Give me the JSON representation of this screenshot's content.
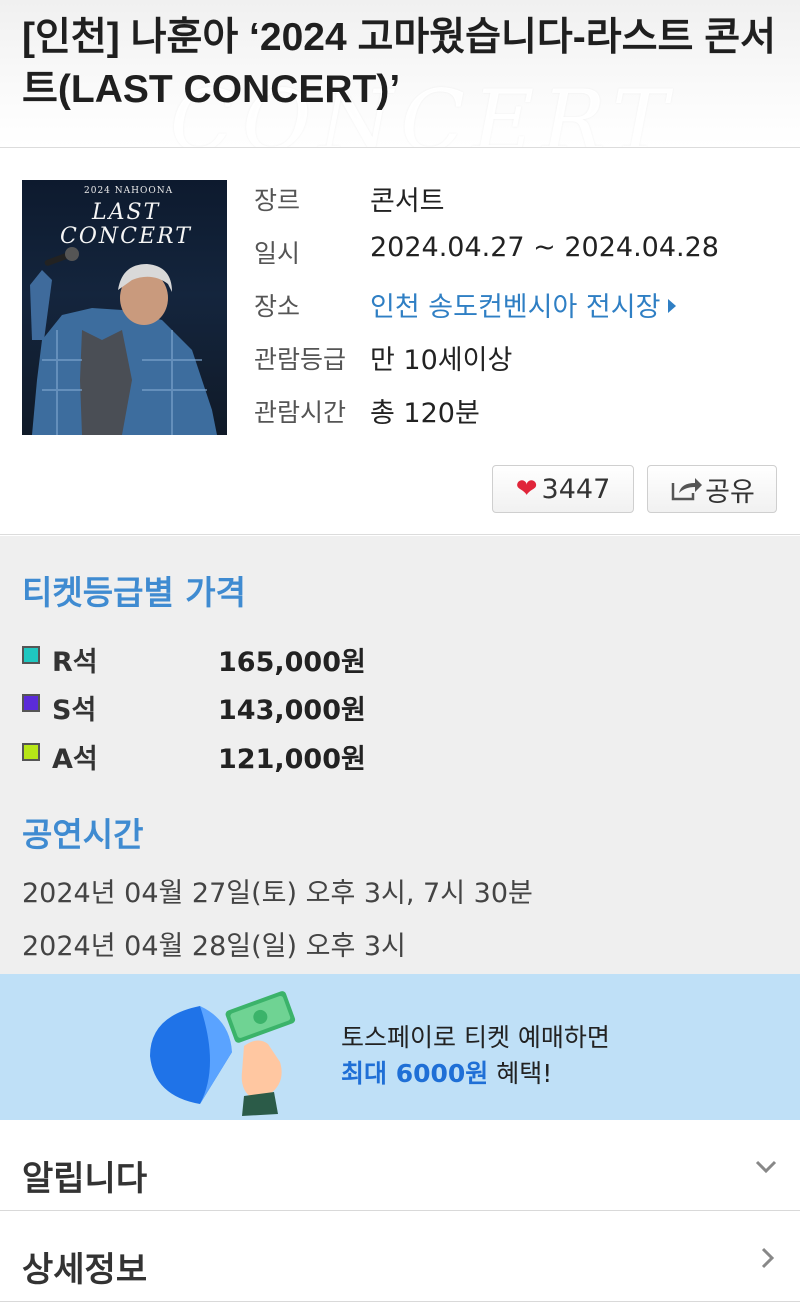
{
  "header": {
    "title": "[인천] 나훈아 ‘2024 고마웠습니다-라스트 콘서트(LAST CONCERT)’",
    "watermark": "CONCERT"
  },
  "poster": {
    "top_text": "2024 NAHOONA",
    "line1": "LAST",
    "line2": "CONCERT"
  },
  "info": {
    "rows": [
      {
        "label": "장르",
        "value": "콘서트"
      },
      {
        "label": "일시",
        "value": "2024.04.27 ~ 2024.04.28"
      },
      {
        "label": "장소",
        "value": "인천 송도컨벤시아 전시장"
      },
      {
        "label": "관람등급",
        "value": "만 10세이상"
      },
      {
        "label": "관람시간",
        "value": "총 120분"
      }
    ],
    "like_count": "3447",
    "share_label": "공유"
  },
  "prices": {
    "title": "티켓등급별 가격",
    "items": [
      {
        "grade": "R석",
        "price": "165,000원",
        "color": "#1fc7c0"
      },
      {
        "grade": "S석",
        "price": "143,000원",
        "color": "#5b2bd9"
      },
      {
        "grade": "A석",
        "price": "121,000원",
        "color": "#b7e617"
      }
    ]
  },
  "showtime": {
    "title": "공연시간",
    "lines": [
      "2024년 04월 27일(토) 오후 3시, 7시 30분",
      "2024년 04월 28일(일) 오후 3시"
    ]
  },
  "banner": {
    "line1": "토스페이로 티켓 예매하면",
    "line2_highlight": "최대 6000원",
    "line2_rest": " 혜택!"
  },
  "accordion": [
    {
      "title": "알립니다",
      "icon": "chevron-down-icon"
    },
    {
      "title": "상세정보",
      "icon": "chevron-right-icon"
    }
  ],
  "colors": {
    "accent": "#3f8bd1",
    "link": "#2f7fc4",
    "heart": "#e0253a"
  }
}
